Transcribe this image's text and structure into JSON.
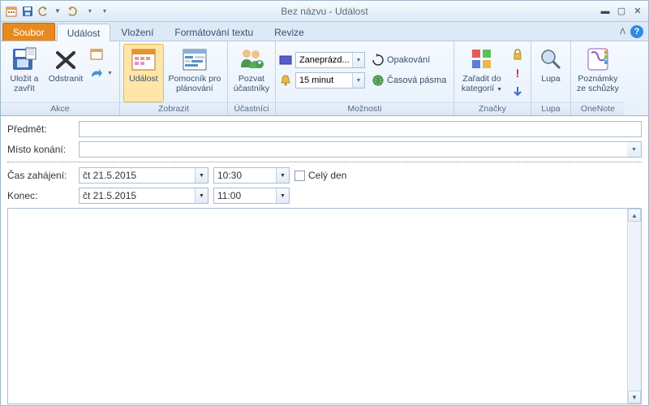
{
  "window": {
    "title": "Bez názvu - Událost"
  },
  "tabs": {
    "file": "Soubor",
    "items": [
      "Událost",
      "Vložení",
      "Formátování textu",
      "Revize"
    ],
    "active": 0
  },
  "ribbon": {
    "akce": {
      "label": "Akce",
      "save_close": "Uložit a zavřít",
      "delete": "Odstranit"
    },
    "zobrazit": {
      "label": "Zobrazit",
      "event": "Událost",
      "scheduler": "Pomocník pro plánování"
    },
    "ucastnici": {
      "label": "Účastníci",
      "invite": "Pozvat účastníky"
    },
    "moznosti": {
      "label": "Možnosti",
      "busy": "Zaneprázd...",
      "recurrence": "Opakování",
      "reminder": "15 minut",
      "timezones": "Časová pásma"
    },
    "znacky": {
      "label": "Značky",
      "categorize": "Zařadit do kategorií"
    },
    "lupa": {
      "label": "Lupa",
      "zoom": "Lupa"
    },
    "onenote": {
      "label": "OneNote",
      "notes": "Poznámky ze schůzky"
    }
  },
  "form": {
    "subject_label": "Předmět:",
    "subject_value": "",
    "location_label": "Místo konání:",
    "location_value": "",
    "start_label": "Čas zahájení:",
    "start_date": "čt 21.5.2015",
    "start_time": "10:30",
    "end_label": "Konec:",
    "end_date": "čt 21.5.2015",
    "end_time": "11:00",
    "allday_label": "Celý den",
    "allday_checked": false,
    "body": ""
  }
}
